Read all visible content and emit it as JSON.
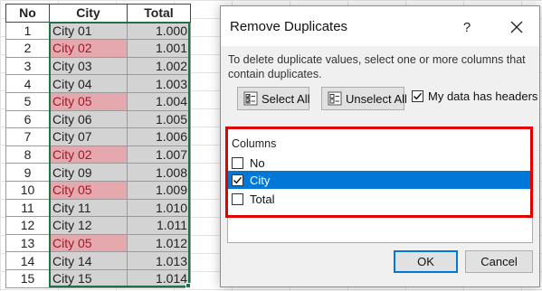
{
  "sheet": {
    "headers": [
      "No",
      "City",
      "Total"
    ],
    "rows": [
      {
        "no": "1",
        "city": "City 01",
        "total": "1.000",
        "duplicate": false
      },
      {
        "no": "2",
        "city": "City 02",
        "total": "1.001",
        "duplicate": true
      },
      {
        "no": "3",
        "city": "City 03",
        "total": "1.002",
        "duplicate": false
      },
      {
        "no": "4",
        "city": "City 04",
        "total": "1.003",
        "duplicate": false
      },
      {
        "no": "5",
        "city": "City 05",
        "total": "1.004",
        "duplicate": true
      },
      {
        "no": "6",
        "city": "City 06",
        "total": "1.005",
        "duplicate": false
      },
      {
        "no": "7",
        "city": "City 07",
        "total": "1.006",
        "duplicate": false
      },
      {
        "no": "8",
        "city": "City 02",
        "total": "1.007",
        "duplicate": true
      },
      {
        "no": "9",
        "city": "City 09",
        "total": "1.008",
        "duplicate": false
      },
      {
        "no": "10",
        "city": "City 05",
        "total": "1.009",
        "duplicate": true
      },
      {
        "no": "11",
        "city": "City 11",
        "total": "1.010",
        "duplicate": false
      },
      {
        "no": "12",
        "city": "City 12",
        "total": "1.011",
        "duplicate": false
      },
      {
        "no": "13",
        "city": "City 05",
        "total": "1.012",
        "duplicate": true
      },
      {
        "no": "14",
        "city": "City 14",
        "total": "1.013",
        "duplicate": false
      },
      {
        "no": "15",
        "city": "City 15",
        "total": "1.014",
        "duplicate": false
      }
    ],
    "duplicate_fill": "#e4a8ae",
    "duplicate_text": "#a31826",
    "selection_color": "#217346"
  },
  "dialog": {
    "title": "Remove Duplicates",
    "help_label": "?",
    "instructions": "To delete duplicate values, select one or more columns that contain duplicates.",
    "select_all_label": "Select All",
    "unselect_all_label": "Unselect All",
    "headers_checkbox": {
      "label": "My data has headers",
      "checked": true
    },
    "columns_label": "Columns",
    "columns": [
      {
        "label": "No",
        "checked": false,
        "selected": false
      },
      {
        "label": "City",
        "checked": true,
        "selected": true
      },
      {
        "label": "Total",
        "checked": false,
        "selected": false
      }
    ],
    "ok_label": "OK",
    "cancel_label": "Cancel",
    "highlight_color": "#e00000",
    "selection_highlight": "#0078d7"
  }
}
